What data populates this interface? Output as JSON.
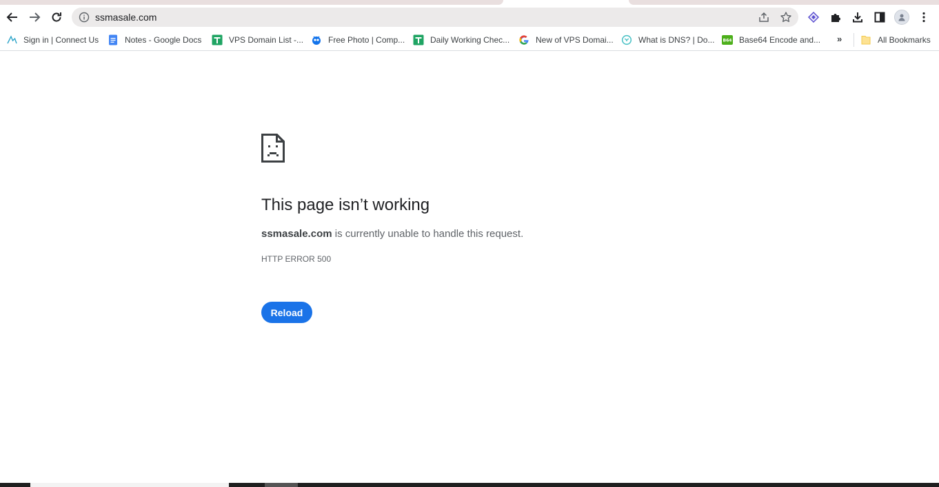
{
  "browser": {
    "url": "ssmasale.com",
    "bookmarks": [
      {
        "label": "Sign in | Connect Us",
        "icon": "connect-icon"
      },
      {
        "label": "Notes - Google Docs",
        "icon": "google-docs-icon"
      },
      {
        "label": "VPS Domain List -...",
        "icon": "google-sheets-icon"
      },
      {
        "label": "Free Photo | Comp...",
        "icon": "freepik-icon"
      },
      {
        "label": "Daily Working Chec...",
        "icon": "google-sheets-icon"
      },
      {
        "label": "New of VPS Domai...",
        "icon": "google-icon"
      },
      {
        "label": "What is DNS? | Do...",
        "icon": "cloudflare-icon"
      },
      {
        "label": "Base64 Encode and...",
        "icon": "base64-icon"
      }
    ],
    "more_bookmarks": "»",
    "all_bookmarks": "All Bookmarks"
  },
  "error": {
    "title": "This page isn’t working",
    "domain": "ssmasale.com",
    "message": " is currently unable to handle this request.",
    "code": "HTTP ERROR 500",
    "reload_label": "Reload"
  },
  "colors": {
    "accent": "#1a73e8",
    "omnibox_bg": "#eceaea"
  }
}
